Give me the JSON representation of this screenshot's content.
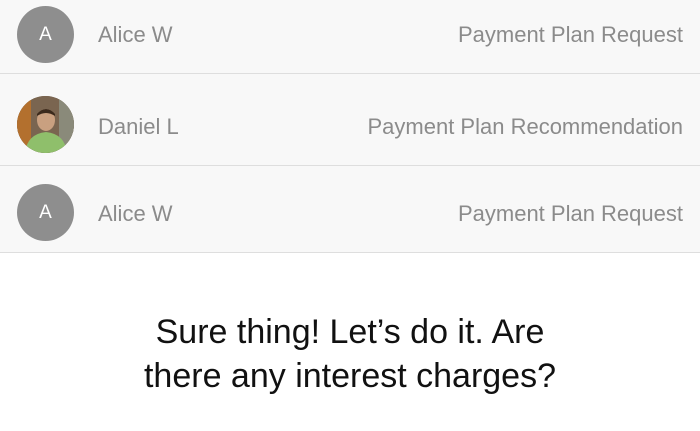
{
  "threads": [
    {
      "avatar_initial": "A",
      "name": "Alice W",
      "subject": "Payment Plan Request"
    },
    {
      "avatar_initial": "",
      "name": "Daniel L",
      "subject": "Payment Plan Recommendation"
    },
    {
      "avatar_initial": "A",
      "name": "Alice W",
      "subject": "Payment Plan Request"
    }
  ],
  "message": {
    "line1": "Sure thing! Let’s do it. Are",
    "line2": "there any interest charges?"
  },
  "colors": {
    "avatar_gray": "#8e8e8e",
    "muted_text": "#8b8b8b",
    "divider": "#dedede",
    "message_text": "#111111"
  }
}
